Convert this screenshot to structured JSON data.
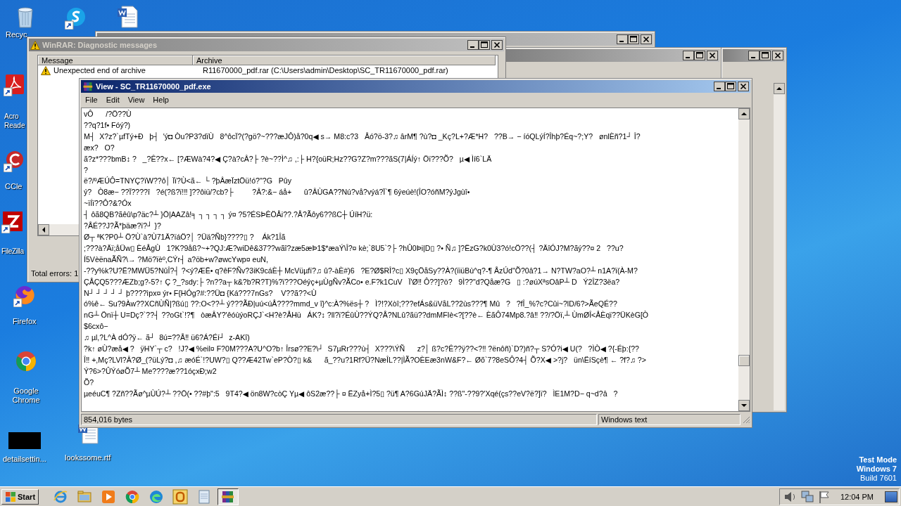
{
  "desktop_icons": [
    {
      "kind": "recycle",
      "label": "Recyc"
    },
    {
      "kind": "skype"
    },
    {
      "kind": "word"
    },
    {
      "kind": "acrobat",
      "label": "Acro Reade"
    },
    {
      "kind": "ccleaner",
      "label": "CCle"
    },
    {
      "kind": "filezilla",
      "label": "FileZilla"
    },
    {
      "kind": "firefox",
      "label": "Firefox"
    },
    {
      "kind": "chrome",
      "label": "Google Chrome"
    },
    {
      "kind": "blank",
      "label": "detailsettin..."
    },
    {
      "kind": "word",
      "label": "lookssome.rtf"
    }
  ],
  "diagnostic_window": {
    "title": "WinRAR: Diagnostic messages",
    "columns": [
      "Message",
      "Archive"
    ],
    "rows": [
      {
        "message": "Unexpected end of archive",
        "archive": "R11670000_pdf.rar (C:\\Users\\admin\\Desktop\\SC_TR11670000_pdf.rar)"
      }
    ],
    "footer": "Total errors: 1"
  },
  "viewer": {
    "title": "View - SC_TR11670000_pdf.exe",
    "menu": [
      "File",
      "Edit",
      "View",
      "Help"
    ],
    "lines": [
      "vÔ      /?Ö??Ù",
      "??q?1f• Fóý?)",
      "M┤  X?z?`µfTý+Ð   þ┤  'ý◘ Òu?P3?dïÙ   8^ôcÏ?(?gö?~???æJÔ)å?0q◀ s→ M8:c?3   Åó?ö-3?♫ ârM¶ ?ù?◘ _Kç?L+?Æ*H?   ??B→ − íóQLýÍ?Îhþ?Éq~?;Y?   ønlÈñ?1┘ Î?",
      "æx?   O?",
      "ã?z*???bmB↕ ?   _?Ê??x← [?ÆWà?4?◀ Ç?à?cÂ?├ ?è~??Ì^♫ ,:├ H?{oüR;Hz??G?Z?m???ãS(7|ÁÍý↑ Öï???Õ?   µ◀ Ìí6`LÄ",
      "?",
      "ë?/ºÆÚÔ=TNYÇ?ïW??ô│ Ïï?Ù<ã← └ ?þÂæÏztÖü!ó?\"?G   Pûy",
      "ý?   Ò8æ− ??Ï????î   ?é(?ß?ï!‼ ]??ôiü/?cb?├         ?Â?:&− áå+      û?ÂÙGA??Nú?vå?výá?Ï`¶ 6ýeúè!(ÎO?óñM?ýJgùî•",
      "~ïÍï??Ô?&?Óx",
      "┤ ôã8QB?ãêû\\p?äc?┴ }Ö|AAZâ!╕ ┐ ┐ ┐ ┐ ý¤ ?5?ÉSÞÊÖÅi??.?Å?Ãôy6??ßC┼ ÚíH?ü:",
      "?ÅÉ??J?Ã*þäæ?ï?┘ }?",
      "Ø┬ ªK?P0┴ Ö?Ù`à?Ù71Ä?ïáÖ?│ ?Üä?Ñb}????▯ ?    Ák?1Îã",
      ";???à?Äï;åÜw▯ ÈéÅgÙ   1?K?9åß?~+?QJ:Æ?wiDê&37??wãî?zæ5æÞ1$*æaÝ\\Î?¤ kè;`8U5`?├ ?hÛ0Þi|D▯ ?• Ñ♫ ]?ËzG?k0Ù3?ó!cÖ??(┤ ?ÄîÓJ?M?ãý??¤ 2   ??u?",
      "Í5VèënaÃÑ?\\→ ?Mö?ïèº,CÝr┤ a?öb+w?øwcYwp¤ euN,",
      "-??y%k?U?Ë?MWÜ5?NûÎ?┤ ?<ý?ÆË• q?êF?Ñv?3iK9cáÈ┼ McVüµfï?♫ û?-àÈ#)6   ?E?Ø$RÎ?c▯ X9çÖåSy??À?(ïiüBù^q?-¶ ÅzÚd\"Õ?0â?1→ N?TW?aO?┴ n1A?ï(À-M?",
      "ÇÅÇQ5???ÆZb;g?-5?↑ Ç ?_?sdy:├ ?n??a┬ k&?b?R?T)%?ï???Oéýç+µÙgÑv?ÃCo• e.F?k1CuV   Ï'Ø‼ Ô??]?ö?   9Ì??\"d?Qåæ?G   ▯ :?øúXªsOâP┴ D   Ý2ÎZ?3ëa?",
      "N┘ ┘ ┘ ┘ ┘ þ????ìpx¤ ýr• F{HÓg?#:??Ü◘ {Ká???7nGs?    V??ã??<Ù",
      "ó%ê← Su?9Àw??XCñÙÑ|?ßú▯ ??:O<??┴ ý???ÃÐ|uú<úÅ????mmd_v î}^c:À?%ës┼ ?   Ì?!?Xòî;???efÁs&üVåL??2ùs???¶ Mû   ?   ?fÎ_%?c?Cûi~?lD/6?>ÃeQÉ??",
      "nG┴ Önï┼ U=Dç?`??┤ ??oGt`!?¶   òæÂY?'êóùýoRÇJ`<H?è?ÅHü   ÁK?↕ ?ll?ï?ÉûÙ??ÝQ?Å?NLû?ãü??dmMFIè<?[??è← ÈãÔ74Mp8.?â‼ ??/?Öï,┴ ÙmØÎ<ÅÈqï??ÜKèG[Ò",
      "$6cxô−",
      "♫ µl,?L^À dÓ?ÿ← ã┘  8ú=??Å‼ ü6?Á?Éí┘  z-AKî)",
      "?k↑ øÙ?æå◀ ?   ÿHY`┬ c?   !J?◀ %eil¤ F?0M???A?U^O?b↑ Îrsø??E?\\┘  S7µRr???ù┤  X???\\ÝÑ      z?│ ß?c?Ê??ÿ??<?‼ ?ënôñ)`D?)ñ?┬ S?Ó?i◀ U(?   ?ÌÒ◀ ?{-Éþ:{??",
      "Î‼ +,Mç?LVl?Â?Ø_(?üLý?◘ ,♫ æóÉ`!?UW?▯ Q??Æ42Tw`eP?Ò?▯ k&      ã_??u?1Rf?Ü?NæÎL??|ÌÃ?OÈEæ3nW&F?← Øõ`7?8eSÔ?4┤ Õ?X◀ >?j?   ün\\ËíSçè¶ ← ?f?♫ ?>",
      "Ý?6>?ÛÝóøÕ7┴ Me????æ??1óçxÐ;w2",
      "Õ?",
      "µeéuC¶ ?Zñ??Ãø^µÙÚ?┴ ??Ö(• ??#þ\":5   9T4?◀ ön8W?còÇ Yµ◀ ôS2æ??├ ¤ ËZyå+Ì?5▯ ?ü¶ A?6GúJÄ?ÃÌ↕ ??ß\"-??9?'Xqé(çs??eV?ë?]ï?   ÌE1M?D− q~d?â   ?"
    ],
    "status": [
      "854,016 bytes",
      "Windows text"
    ]
  },
  "system_notice": [
    "Test Mode",
    "Windows 7",
    "Build 7601"
  ],
  "taskbar": {
    "start": "Start",
    "apps": [
      {
        "kind": "ie",
        "selected": false
      },
      {
        "kind": "explorer",
        "selected": false
      },
      {
        "kind": "media",
        "selected": false
      },
      {
        "kind": "chrome",
        "selected": false
      },
      {
        "kind": "edge",
        "selected": false
      },
      {
        "kind": "office",
        "selected": false
      },
      {
        "kind": "notepad",
        "selected": false
      },
      {
        "kind": "winrar",
        "selected": true
      }
    ],
    "tray": [
      {
        "kind": "speaker"
      },
      {
        "kind": "network"
      },
      {
        "kind": "flag"
      }
    ],
    "clock": "12:04 PM"
  }
}
